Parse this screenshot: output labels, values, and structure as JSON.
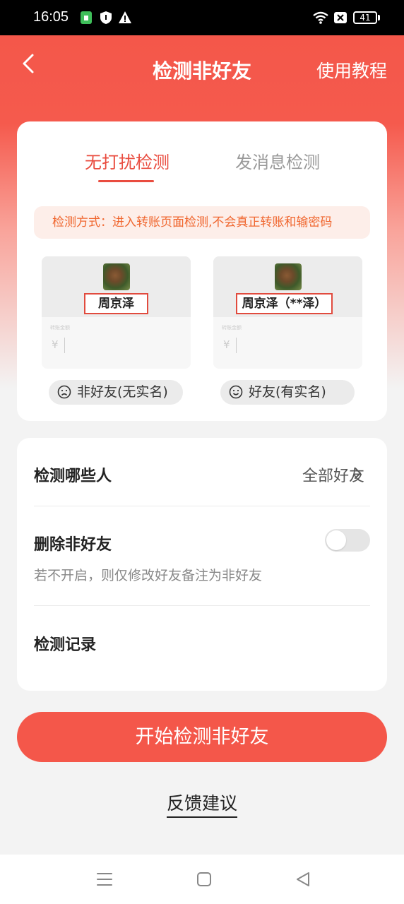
{
  "status_bar": {
    "time": "16:05",
    "battery": "41",
    "icons": [
      "sim-icon",
      "shield-icon",
      "warning-icon",
      "wifi-icon",
      "no-sim-icon",
      "battery-icon"
    ]
  },
  "header": {
    "title": "检测非好友",
    "tutorial": "使用教程",
    "back_icon": "chevron-left-icon"
  },
  "mode_card": {
    "tabs": [
      {
        "label": "无打扰检测",
        "active": true
      },
      {
        "label": "发消息检测",
        "active": false
      }
    ],
    "tip": "检测方式：进入转账页面检测,不会真正转账和输密码",
    "examples": [
      {
        "name": "周京泽",
        "small_label": "转账金额",
        "currency": "¥",
        "badge": "非好友(无实名)",
        "badge_icon": "sad-face-icon"
      },
      {
        "name": "周京泽（**泽）",
        "small_label": "转账金额",
        "currency": "¥",
        "badge": "好友(有实名)",
        "badge_icon": "smile-face-icon"
      }
    ]
  },
  "settings": {
    "target_label": "检测哪些人",
    "target_value": "全部好友",
    "delete_label": "删除非好友",
    "delete_enabled": false,
    "delete_hint": "若不开启，则仅修改好友备注为非好友",
    "history_label": "检测记录"
  },
  "start_button": "开始检测非好友",
  "feedback": "反馈建议",
  "colors": {
    "accent": "#f4574a",
    "tab_active": "#e94c3f",
    "tip_text": "#f0662e",
    "tip_bg": "#fdeee9"
  }
}
